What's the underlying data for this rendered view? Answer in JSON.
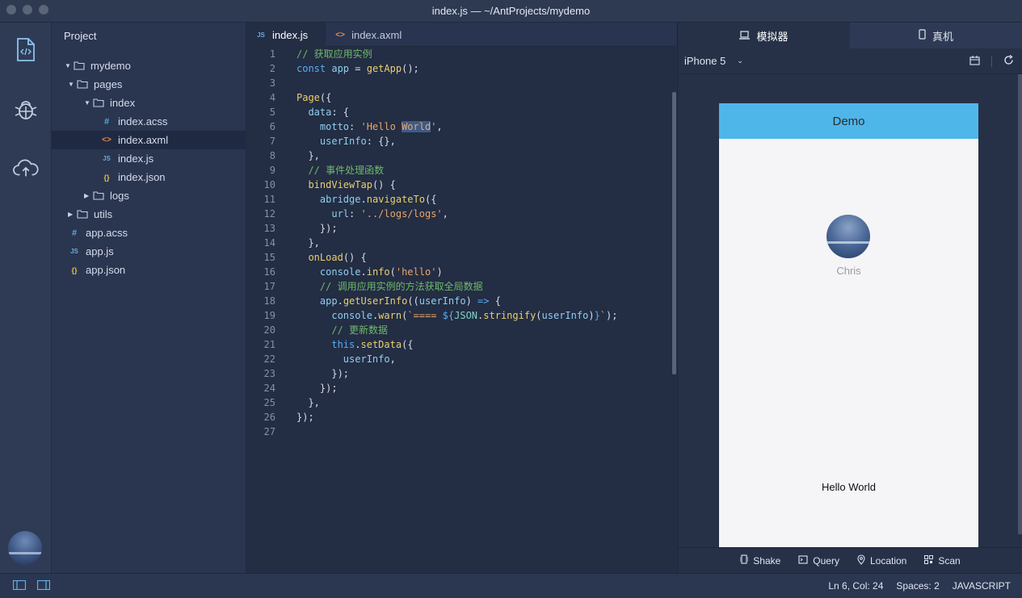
{
  "window": {
    "title": "index.js — ~/AntProjects/mydemo"
  },
  "activity": {
    "icons": [
      "file-code-icon",
      "bug-icon",
      "cloud-upload-icon"
    ]
  },
  "sidebar": {
    "title": "Project",
    "tree": [
      {
        "label": "mydemo",
        "type": "folder",
        "open": true
      },
      {
        "label": "pages",
        "type": "folder",
        "open": true
      },
      {
        "label": "index",
        "type": "folder",
        "open": true
      },
      {
        "label": "index.acss",
        "type": "acss"
      },
      {
        "label": "index.axml",
        "type": "axml"
      },
      {
        "label": "index.js",
        "type": "js"
      },
      {
        "label": "index.json",
        "type": "json"
      },
      {
        "label": "logs",
        "type": "folder",
        "open": false
      },
      {
        "label": "utils",
        "type": "folder",
        "open": false
      },
      {
        "label": "app.acss",
        "type": "acss"
      },
      {
        "label": "app.js",
        "type": "js"
      },
      {
        "label": "app.json",
        "type": "json"
      }
    ]
  },
  "editor": {
    "tabs": [
      {
        "label": "index.js",
        "type": "js",
        "active": true
      },
      {
        "label": "index.axml",
        "type": "axml",
        "active": false
      }
    ],
    "lines": [
      [
        [
          "c-com",
          "// 获取应用实例"
        ]
      ],
      [
        [
          "c-kw",
          "const "
        ],
        [
          "c-pr",
          "app"
        ],
        [
          "c-p",
          " = "
        ],
        [
          "c-fn",
          "getApp"
        ],
        [
          "c-p",
          "();"
        ]
      ],
      [],
      [
        [
          "c-fn",
          "Page"
        ],
        [
          "c-p",
          "({"
        ]
      ],
      [
        [
          "c-p",
          "  "
        ],
        [
          "c-pr",
          "data"
        ],
        [
          "c-p",
          ": {"
        ]
      ],
      [
        [
          "c-p",
          "    "
        ],
        [
          "c-pr",
          "motto"
        ],
        [
          "c-p",
          ": "
        ],
        [
          "c-str",
          "'Hello "
        ],
        [
          "sel",
          "World"
        ],
        [
          "c-str",
          "'"
        ],
        [
          "c-p",
          ","
        ]
      ],
      [
        [
          "c-p",
          "    "
        ],
        [
          "c-pr",
          "userInfo"
        ],
        [
          "c-p",
          ": {},"
        ]
      ],
      [
        [
          "c-p",
          "  },"
        ]
      ],
      [
        [
          "c-p",
          "  "
        ],
        [
          "c-com",
          "// 事件处理函数"
        ]
      ],
      [
        [
          "c-p",
          "  "
        ],
        [
          "c-fn",
          "bindViewTap"
        ],
        [
          "c-p",
          "() {"
        ]
      ],
      [
        [
          "c-p",
          "    "
        ],
        [
          "c-pr",
          "abridge"
        ],
        [
          "c-p",
          "."
        ],
        [
          "c-fn",
          "navigateTo"
        ],
        [
          "c-p",
          "({"
        ]
      ],
      [
        [
          "c-p",
          "      "
        ],
        [
          "c-pr",
          "url"
        ],
        [
          "c-p",
          ": "
        ],
        [
          "c-str",
          "'../logs/logs'"
        ],
        [
          "c-p",
          ","
        ]
      ],
      [
        [
          "c-p",
          "    });"
        ]
      ],
      [
        [
          "c-p",
          "  },"
        ]
      ],
      [
        [
          "c-p",
          "  "
        ],
        [
          "c-fn",
          "onLoad"
        ],
        [
          "c-p",
          "() {"
        ]
      ],
      [
        [
          "c-p",
          "    "
        ],
        [
          "c-pr",
          "console"
        ],
        [
          "c-p",
          "."
        ],
        [
          "c-fn",
          "info"
        ],
        [
          "c-p",
          "("
        ],
        [
          "c-str",
          "'hello'"
        ],
        [
          "c-p",
          ")"
        ]
      ],
      [
        [
          "c-p",
          "    "
        ],
        [
          "c-com",
          "// 调用应用实例的方法获取全局数据"
        ]
      ],
      [
        [
          "c-p",
          "    "
        ],
        [
          "c-pr",
          "app"
        ],
        [
          "c-p",
          "."
        ],
        [
          "c-fn",
          "getUserInfo"
        ],
        [
          "c-p",
          "(("
        ],
        [
          "c-pr",
          "userInfo"
        ],
        [
          "c-p",
          ") "
        ],
        [
          "c-kw",
          "=>"
        ],
        [
          "c-p",
          " {"
        ]
      ],
      [
        [
          "c-p",
          "      "
        ],
        [
          "c-pr",
          "console"
        ],
        [
          "c-p",
          "."
        ],
        [
          "c-fn",
          "warn"
        ],
        [
          "c-p",
          "("
        ],
        [
          "c-str",
          "`==== "
        ],
        [
          "c-kw",
          "${"
        ],
        [
          "c-cls",
          "JSON"
        ],
        [
          "c-p",
          "."
        ],
        [
          "c-fn",
          "stringify"
        ],
        [
          "c-p",
          "("
        ],
        [
          "c-pr",
          "userInfo"
        ],
        [
          "c-p",
          ")"
        ],
        [
          "c-kw",
          "}"
        ],
        [
          "c-str",
          "`"
        ],
        [
          "c-p",
          ");"
        ]
      ],
      [
        [
          "c-p",
          "      "
        ],
        [
          "c-com",
          "// 更新数据"
        ]
      ],
      [
        [
          "c-p",
          "      "
        ],
        [
          "c-kw",
          "this"
        ],
        [
          "c-p",
          "."
        ],
        [
          "c-fn",
          "setData"
        ],
        [
          "c-p",
          "({"
        ]
      ],
      [
        [
          "c-p",
          "        "
        ],
        [
          "c-pr",
          "userInfo"
        ],
        [
          "c-p",
          ","
        ]
      ],
      [
        [
          "c-p",
          "      });"
        ]
      ],
      [
        [
          "c-p",
          "    });"
        ]
      ],
      [
        [
          "c-p",
          "  },"
        ]
      ],
      [
        [
          "c-p",
          "});"
        ]
      ],
      []
    ]
  },
  "simulator": {
    "tabs": [
      {
        "label": "模拟器",
        "icon": "laptop-icon",
        "active": true
      },
      {
        "label": "真机",
        "icon": "mobile-icon",
        "active": false
      }
    ],
    "device": "iPhone 5",
    "phone": {
      "nav_title": "Demo",
      "user_name": "Chris",
      "motto": "Hello World"
    },
    "bottom_actions": [
      {
        "label": "Shake",
        "icon": "shake-icon"
      },
      {
        "label": "Query",
        "icon": "query-icon"
      },
      {
        "label": "Location",
        "icon": "location-icon"
      },
      {
        "label": "Scan",
        "icon": "scan-icon"
      }
    ]
  },
  "status": {
    "cursor": "Ln 6, Col: 24",
    "spaces": "Spaces: 2",
    "language": "JAVASCRIPT"
  }
}
